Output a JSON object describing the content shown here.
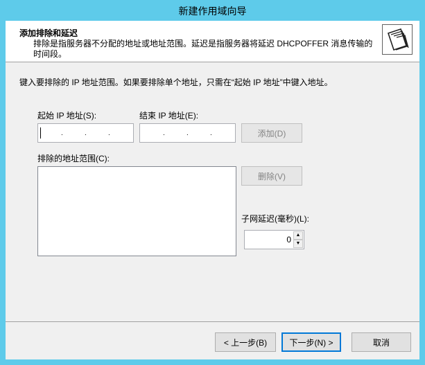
{
  "window": {
    "title": "新建作用域向导"
  },
  "header": {
    "title": "添加排除和延迟",
    "description": "排除是指服务器不分配的地址或地址范围。延迟是指服务器将延迟 DHCPOFFER 消息传输的时间段。",
    "icon": "wizard-folders-icon"
  },
  "instruction": "键入要排除的 IP 地址范围。如果要排除单个地址，只需在“起始 IP 地址”中键入地址。",
  "start_ip": {
    "label": "起始 IP 地址(S):",
    "value": ""
  },
  "end_ip": {
    "label": "结束 IP 地址(E):",
    "value": ""
  },
  "ip_dot": ".",
  "add_button": "添加(D)",
  "range_list": {
    "label": "排除的地址范围(C):",
    "items": []
  },
  "remove_button": "删除(V)",
  "subnet_delay": {
    "label": "子网延迟(毫秒)(L):",
    "value": "0"
  },
  "nav": {
    "back": "< 上一步(B)",
    "next": "下一步(N) >",
    "cancel": "取消"
  }
}
